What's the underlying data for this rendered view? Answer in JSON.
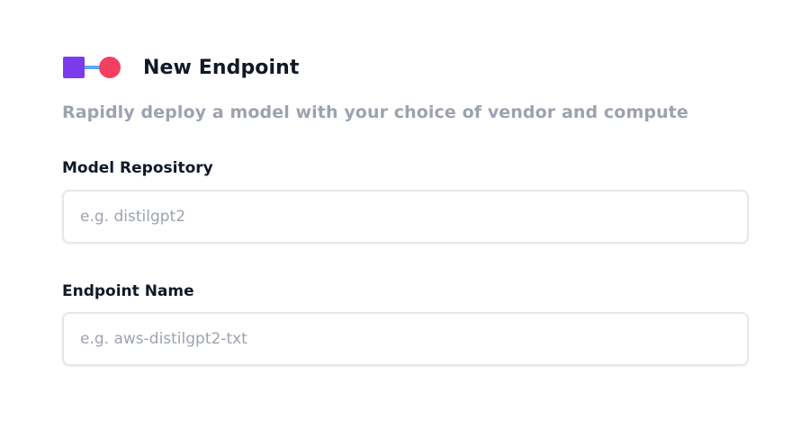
{
  "header": {
    "logo_icon": "endpoint-connector-icon",
    "title": "New Endpoint"
  },
  "subtitle": "Rapidly deploy a model with your choice of vendor and compute",
  "form": {
    "model_repository": {
      "label": "Model Repository",
      "value": "",
      "placeholder": "e.g. distilgpt2"
    },
    "endpoint_name": {
      "label": "Endpoint Name",
      "value": "",
      "placeholder": "e.g. aws-distilgpt2-txt"
    }
  },
  "colors": {
    "logo_square": "#7c3aed",
    "logo_line": "#60a5fa",
    "logo_circle": "#f43f5e",
    "subtitle": "#9ca3af",
    "input_border": "#e5e7eb"
  }
}
